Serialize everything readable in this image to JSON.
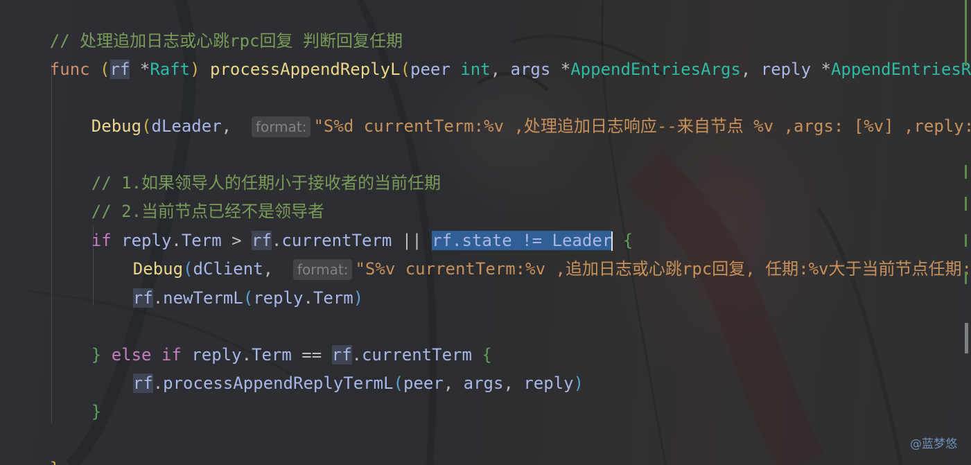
{
  "colors": {
    "keyword": "#cf8e6d",
    "comment": "#7a9a5a",
    "function": "#56a8f5",
    "type": "#2fbaa3",
    "string": "#c7915c",
    "selection": "#2f5f94"
  },
  "lines": {
    "l1": {
      "comment": "// 处理追加日志或心跳rpc回复 判断回复任期"
    },
    "l2": {
      "kw": "func",
      "open": "(",
      "recv": "rf",
      "star": "*",
      "recv_type": "Raft",
      "close": ")",
      "name": "processAppendReplyL",
      "popen": "(",
      "p1": "peer",
      "p1type": "int",
      "comma1": ",",
      "p2": "args",
      "star2": "*",
      "p2type": "AppendEntriesArgs",
      "comma2": ",",
      "p3": "reply",
      "star3": "*",
      "p3type": "AppendEntriesReply"
    },
    "l3": {
      "fn": "Debug",
      "open": "(",
      "arg": "dLeader",
      "comma": ",",
      "hint": "format:",
      "str": "\"S%d currentTerm:%v ,处理追加日志响应--来自节点 %v ,args: [%v] ,reply: [%v]\""
    },
    "l4": {
      "comment": "// 1.如果领导人的任期小于接收者的当前任期"
    },
    "l5": {
      "comment": "// 2.当前节点已经不是领导者"
    },
    "l6": {
      "kw": "if",
      "a": "reply",
      "dot1": ".",
      "af": "Term",
      "op1": ">",
      "b": "rf",
      "dot2": ".",
      "bf": "currentTerm",
      "op2": "||",
      "sel": "rf.state != Leader",
      "brace": "{"
    },
    "l7": {
      "fn": "Debug",
      "open": "(",
      "arg": "dClient",
      "comma": ",",
      "hint": "format:",
      "str": "\"S%v currentTerm:%v ,追加日志或心跳rpc回复, 任期:%v大于当前节点任期:%v\""
    },
    "l8": {
      "recv": "rf",
      "dot": ".",
      "fn": "newTermL",
      "open": "(",
      "a": "reply",
      "dot2": ".",
      "af": "Term",
      "close": ")"
    },
    "l9": {
      "close": "}",
      "kw1": "else",
      "kw2": "if",
      "a": "reply",
      "dot1": ".",
      "af": "Term",
      "op": "==",
      "b": "rf",
      "dot2": ".",
      "bf": "currentTerm",
      "brace": "{"
    },
    "l10": {
      "recv": "rf",
      "dot": ".",
      "fn": "processAppendReplyTermL",
      "open": "(",
      "a1": "peer",
      "c1": ",",
      "a2": "args",
      "c2": ",",
      "a3": "reply",
      "close": ")"
    },
    "l11": {
      "brace": "}"
    },
    "l12": {
      "brace": "}"
    }
  },
  "watermark": "@蓝梦悠"
}
